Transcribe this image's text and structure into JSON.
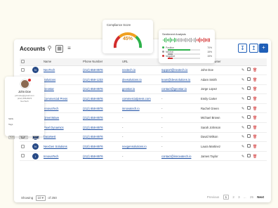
{
  "page": {
    "title": "Accounts"
  },
  "toolbar": {
    "search_icon": "search-icon",
    "grid_icon": "grid-icon",
    "filter_icon": "filter-sliders-icon",
    "export_icon": "download-icon",
    "import_icon": "upload-icon",
    "add_label": "+"
  },
  "table": {
    "headers": [
      "Name",
      "Phone Number",
      "URL",
      "Email",
      "Account Owner"
    ],
    "rows": [
      {
        "name": "NexTech",
        "phone": "(212) 658-8976",
        "url": "nextech.io",
        "email": "support@nextech.io",
        "owner": "John Doe",
        "initial": "N"
      },
      {
        "name": "Solutions",
        "phone": "(212) 658-1233",
        "url": "devsolutions.io",
        "email": "team@devsolutions.io",
        "owner": "Adam Smith",
        "initial": "S"
      },
      {
        "name": "Geostar",
        "phone": "(212) 658-8976",
        "url": "geostar.io",
        "email": "contact@geostar.io",
        "owner": "Jorge Lopez",
        "initial": "G"
      },
      {
        "name": "Commercial Press",
        "phone": "(212) 658-8976",
        "url": "commercialpress.com",
        "email": "-",
        "owner": "Emily Carter",
        "initial": "C"
      },
      {
        "name": "InnovaTech",
        "phone": "(212) 658-8976",
        "url": "innovatech.io",
        "email": "-",
        "owner": "Rachel Green",
        "initial": "I"
      },
      {
        "name": "GreenWave",
        "phone": "(212) 658-8976",
        "url": "-",
        "email": "-",
        "owner": "Michael Brown",
        "initial": "G"
      },
      {
        "name": "Pixel Dynamics",
        "phone": "(212) 658-8976",
        "url": "-",
        "email": "-",
        "owner": "Sarah Johnson",
        "initial": "P"
      },
      {
        "name": "DataNest",
        "phone": "(212) 658-8976",
        "url": "-",
        "email": "-",
        "owner": "David Wilson",
        "initial": "D"
      },
      {
        "name": "NexGen Solutions",
        "phone": "(310) 658-8976",
        "url": "nexgensolutions.io",
        "email": "-",
        "owner": "Laura Martinez",
        "initial": "N"
      },
      {
        "name": "InnovaTech",
        "phone": "(212) 658-8976",
        "url": "-",
        "email": "contact@innovatech.io",
        "owner": "James Taylor",
        "initial": "I"
      }
    ]
  },
  "footer": {
    "showing_label": "Showing",
    "page_size": "10",
    "of_total": "of 250",
    "previous": "Previous",
    "pages": [
      "1",
      "2",
      "3",
      "...",
      "25"
    ],
    "next": "Next"
  },
  "score_card": {
    "title": "Compliance Score",
    "value": "45%",
    "percent": 45
  },
  "sentiment_card": {
    "title": "Sentiment Analysis",
    "items": [
      {
        "label": "Positive",
        "value": "70%",
        "percent": 70,
        "color": "#2db14a"
      },
      {
        "label": "Neutral",
        "value": "15%",
        "percent": 15,
        "color": "#999999"
      },
      {
        "label": "Negative",
        "value": "15%",
        "percent": 15,
        "color": "#d22d2d"
      }
    ]
  },
  "contact_card": {
    "name": "John Doe",
    "email": "johndoe@gmail.com",
    "phone": "(212) 658-8976",
    "role": "NexTech",
    "field1_label": "Skills",
    "field2_label": "Tags",
    "tags": [
      "Tech",
      "Industry",
      "Sales"
    ]
  },
  "colors": {
    "accent": "#1f5fb8",
    "avatar": "#274a86",
    "delete": "#d02e2e",
    "gauge_low": "#d22d2d",
    "gauge_mid": "#f0a020",
    "gauge_high": "#2db14a"
  }
}
